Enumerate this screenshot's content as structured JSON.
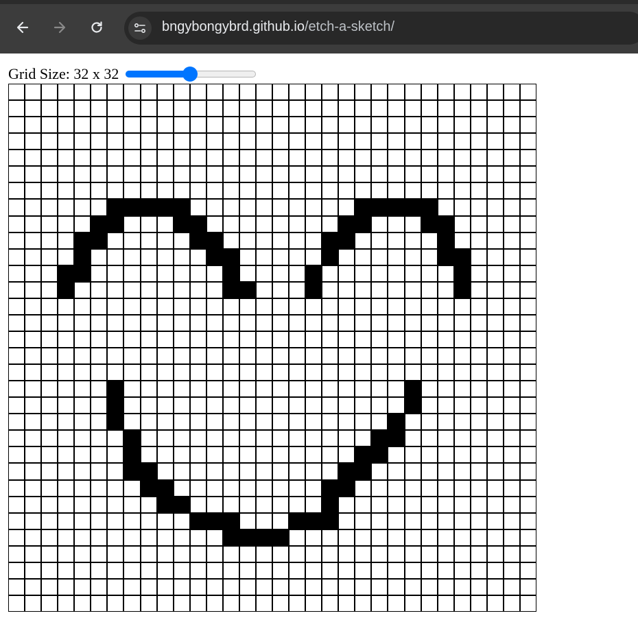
{
  "browser": {
    "url_domain": "bngybongybrd.github.io",
    "url_path": "/etch-a-sketch/",
    "icons": [
      "back-arrow-icon",
      "forward-arrow-icon",
      "reload-icon",
      "site-settings-icon"
    ]
  },
  "controls": {
    "grid_size_label": "Grid Size: 32 x 32",
    "slider_value": 32,
    "slider_min": 1,
    "slider_max": 64,
    "slider_color": "#0075ff"
  },
  "grid": {
    "size": 32,
    "cell_color_on": "#000000",
    "cell_color_off": "#ffffff",
    "filled_cells": [
      [
        7,
        6
      ],
      [
        7,
        7
      ],
      [
        7,
        8
      ],
      [
        7,
        9
      ],
      [
        7,
        10
      ],
      [
        8,
        5
      ],
      [
        8,
        6
      ],
      [
        8,
        10
      ],
      [
        8,
        11
      ],
      [
        9,
        4
      ],
      [
        9,
        5
      ],
      [
        9,
        11
      ],
      [
        9,
        12
      ],
      [
        10,
        4
      ],
      [
        10,
        12
      ],
      [
        10,
        13
      ],
      [
        11,
        3
      ],
      [
        11,
        4
      ],
      [
        11,
        13
      ],
      [
        12,
        3
      ],
      [
        12,
        13
      ],
      [
        12,
        14
      ],
      [
        7,
        21
      ],
      [
        7,
        22
      ],
      [
        7,
        23
      ],
      [
        7,
        24
      ],
      [
        7,
        25
      ],
      [
        8,
        20
      ],
      [
        8,
        21
      ],
      [
        8,
        25
      ],
      [
        8,
        26
      ],
      [
        9,
        19
      ],
      [
        9,
        20
      ],
      [
        9,
        26
      ],
      [
        10,
        19
      ],
      [
        10,
        26
      ],
      [
        10,
        27
      ],
      [
        11,
        18
      ],
      [
        11,
        27
      ],
      [
        12,
        18
      ],
      [
        12,
        27
      ],
      [
        18,
        6
      ],
      [
        18,
        24
      ],
      [
        19,
        6
      ],
      [
        19,
        24
      ],
      [
        20,
        6
      ],
      [
        20,
        23
      ],
      [
        21,
        7
      ],
      [
        21,
        22
      ],
      [
        21,
        23
      ],
      [
        22,
        7
      ],
      [
        22,
        21
      ],
      [
        22,
        22
      ],
      [
        23,
        7
      ],
      [
        23,
        8
      ],
      [
        23,
        20
      ],
      [
        23,
        21
      ],
      [
        24,
        8
      ],
      [
        24,
        9
      ],
      [
        24,
        19
      ],
      [
        24,
        20
      ],
      [
        25,
        9
      ],
      [
        25,
        10
      ],
      [
        25,
        19
      ],
      [
        26,
        11
      ],
      [
        26,
        12
      ],
      [
        26,
        13
      ],
      [
        26,
        17
      ],
      [
        26,
        18
      ],
      [
        26,
        19
      ],
      [
        27,
        13
      ],
      [
        27,
        14
      ],
      [
        27,
        15
      ],
      [
        27,
        16
      ]
    ]
  }
}
